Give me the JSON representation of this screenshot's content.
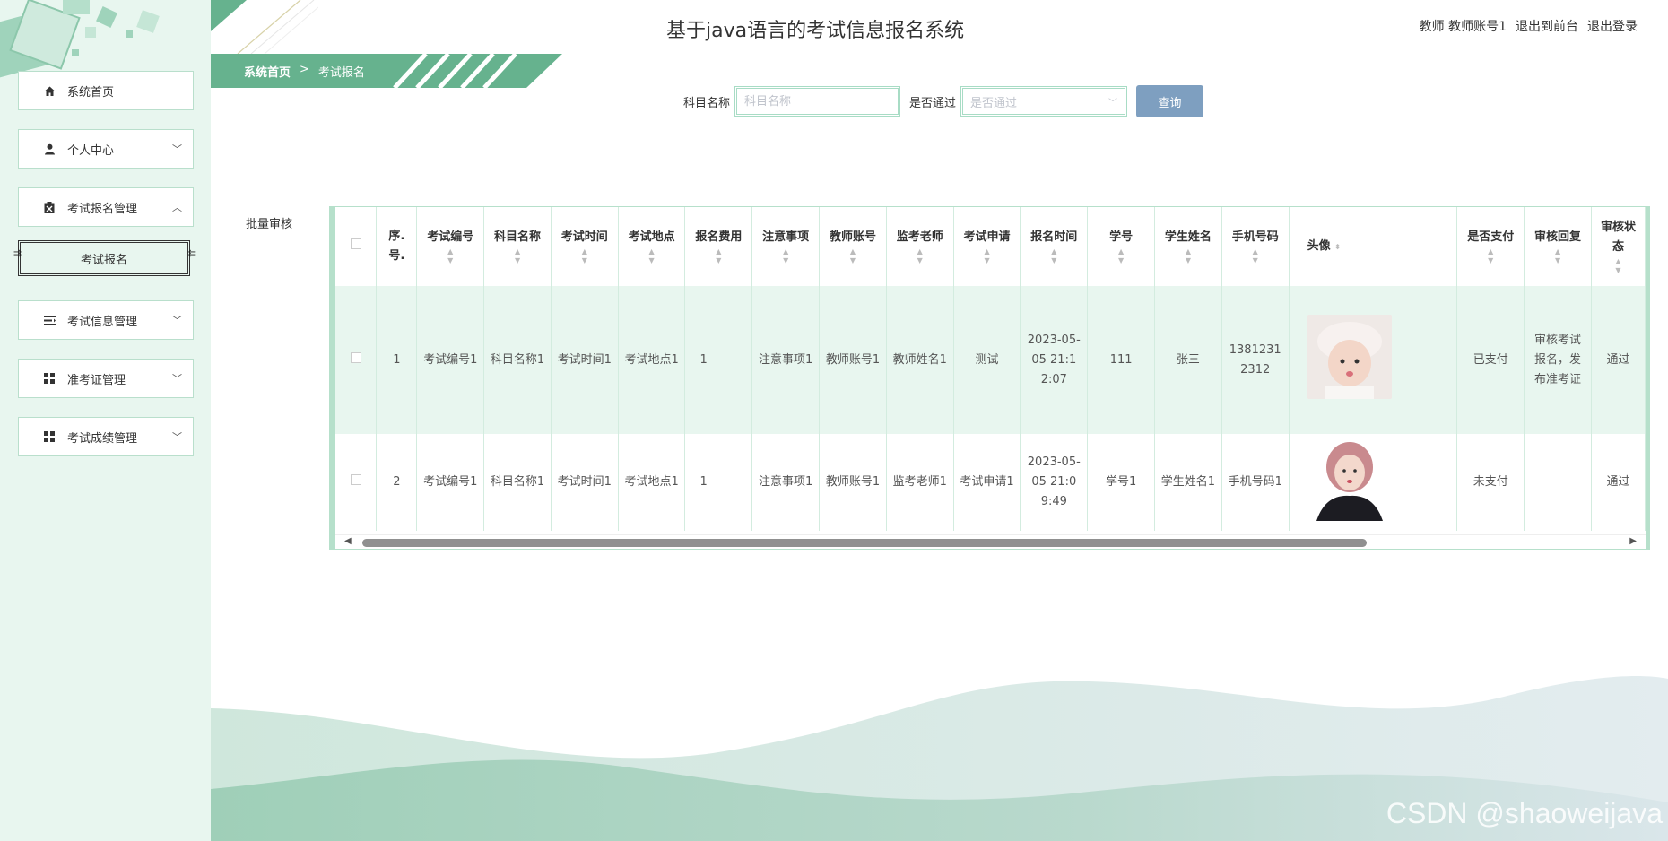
{
  "app_title": "基于java语言的考试信息报名系统",
  "top_links": {
    "user": "教师 教师账号1",
    "to_front": "退出到前台",
    "logout": "退出登录"
  },
  "breadcrumb": {
    "home": "系统首页",
    "sep": ">",
    "current": "考试报名"
  },
  "sidebar": {
    "items": [
      {
        "label": "系统首页",
        "icon": "home-icon"
      },
      {
        "label": "个人中心",
        "icon": "user-icon"
      },
      {
        "label": "考试报名管理",
        "icon": "clipboard-icon"
      },
      {
        "label": "考试报名"
      },
      {
        "label": "考试信息管理",
        "icon": "list-icon"
      },
      {
        "label": "准考证管理",
        "icon": "grid-icon"
      },
      {
        "label": "考试成绩管理",
        "icon": "grid-icon"
      }
    ]
  },
  "search": {
    "subject_label": "科目名称",
    "subject_placeholder": "科目名称",
    "passed_label": "是否通过",
    "passed_placeholder": "是否通过",
    "query_button": "查询"
  },
  "batch_review": "批量审核",
  "table": {
    "headers": [
      "序.号.",
      "考试编号",
      "科目名称",
      "考试时间",
      "考试地点",
      "报名费用",
      "注意事项",
      "教师账号",
      "监考老师",
      "考试申请",
      "报名时间",
      "学号",
      "学生姓名",
      "手机号码",
      "头像",
      "是否支付",
      "审核回复",
      "审核状态"
    ],
    "rows": [
      [
        "1",
        "考试编号1",
        "科目名称1",
        "考试时间1",
        "考试地点1",
        "1",
        "注意事项1",
        "教师账号1",
        "教师姓名1",
        "测试",
        "2023-05-05 21:12:07",
        "111",
        "张三",
        "13812312312",
        "",
        "已支付",
        "审核考试报名，发布准考证",
        "通过"
      ],
      [
        "2",
        "考试编号1",
        "科目名称1",
        "考试时间1",
        "考试地点1",
        "1",
        "注意事项1",
        "教师账号1",
        "监考老师1",
        "考试申请1",
        "2023-05-05 21:09:49",
        "学号1",
        "学生姓名1",
        "手机号码1",
        "",
        "未支付",
        "",
        "通过"
      ]
    ]
  },
  "watermark": "CSDN @shaoweijava",
  "colors": {
    "accent": "#66b28e",
    "sidebar_bg": "#e8f6ef",
    "button": "#7e9fc0",
    "wave": "#a7d3c0"
  }
}
